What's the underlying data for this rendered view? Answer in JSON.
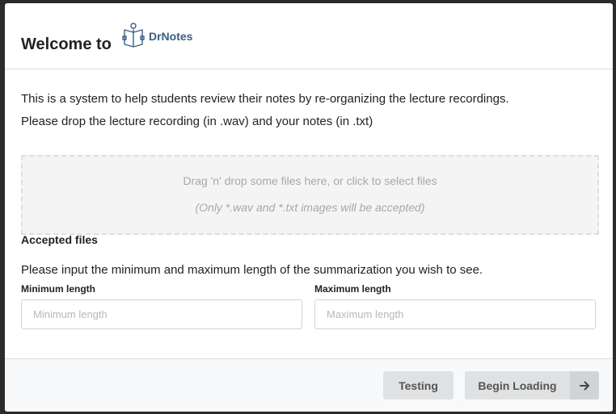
{
  "header": {
    "welcome": "Welcome to",
    "logo_text": "DrNotes"
  },
  "intro": {
    "line1": "This is a system to help students review their notes by re-organizing the lecture recordings.",
    "line2": "Please drop the lecture recording (in .wav) and your notes (in .txt)"
  },
  "dropzone": {
    "main": "Drag 'n' drop some files here, or click to select files",
    "sub": "(Only *.wav and *.txt images will be accepted)"
  },
  "accepted_files_label": "Accepted files",
  "length_instructions": "Please input the minimum and maximum length of the summarization you wish to see.",
  "fields": {
    "min_label": "Minimum length",
    "min_placeholder": "Minimum length",
    "min_value": "",
    "max_label": "Maximum length",
    "max_placeholder": "Maximum length",
    "max_value": ""
  },
  "footer": {
    "testing_label": "Testing",
    "begin_label": "Begin Loading",
    "begin_icon": "arrow-right-icon"
  },
  "colors": {
    "logo": "#3a5f82",
    "button_bg": "#e0e1e2",
    "footer_bg": "#f8f9fa"
  }
}
